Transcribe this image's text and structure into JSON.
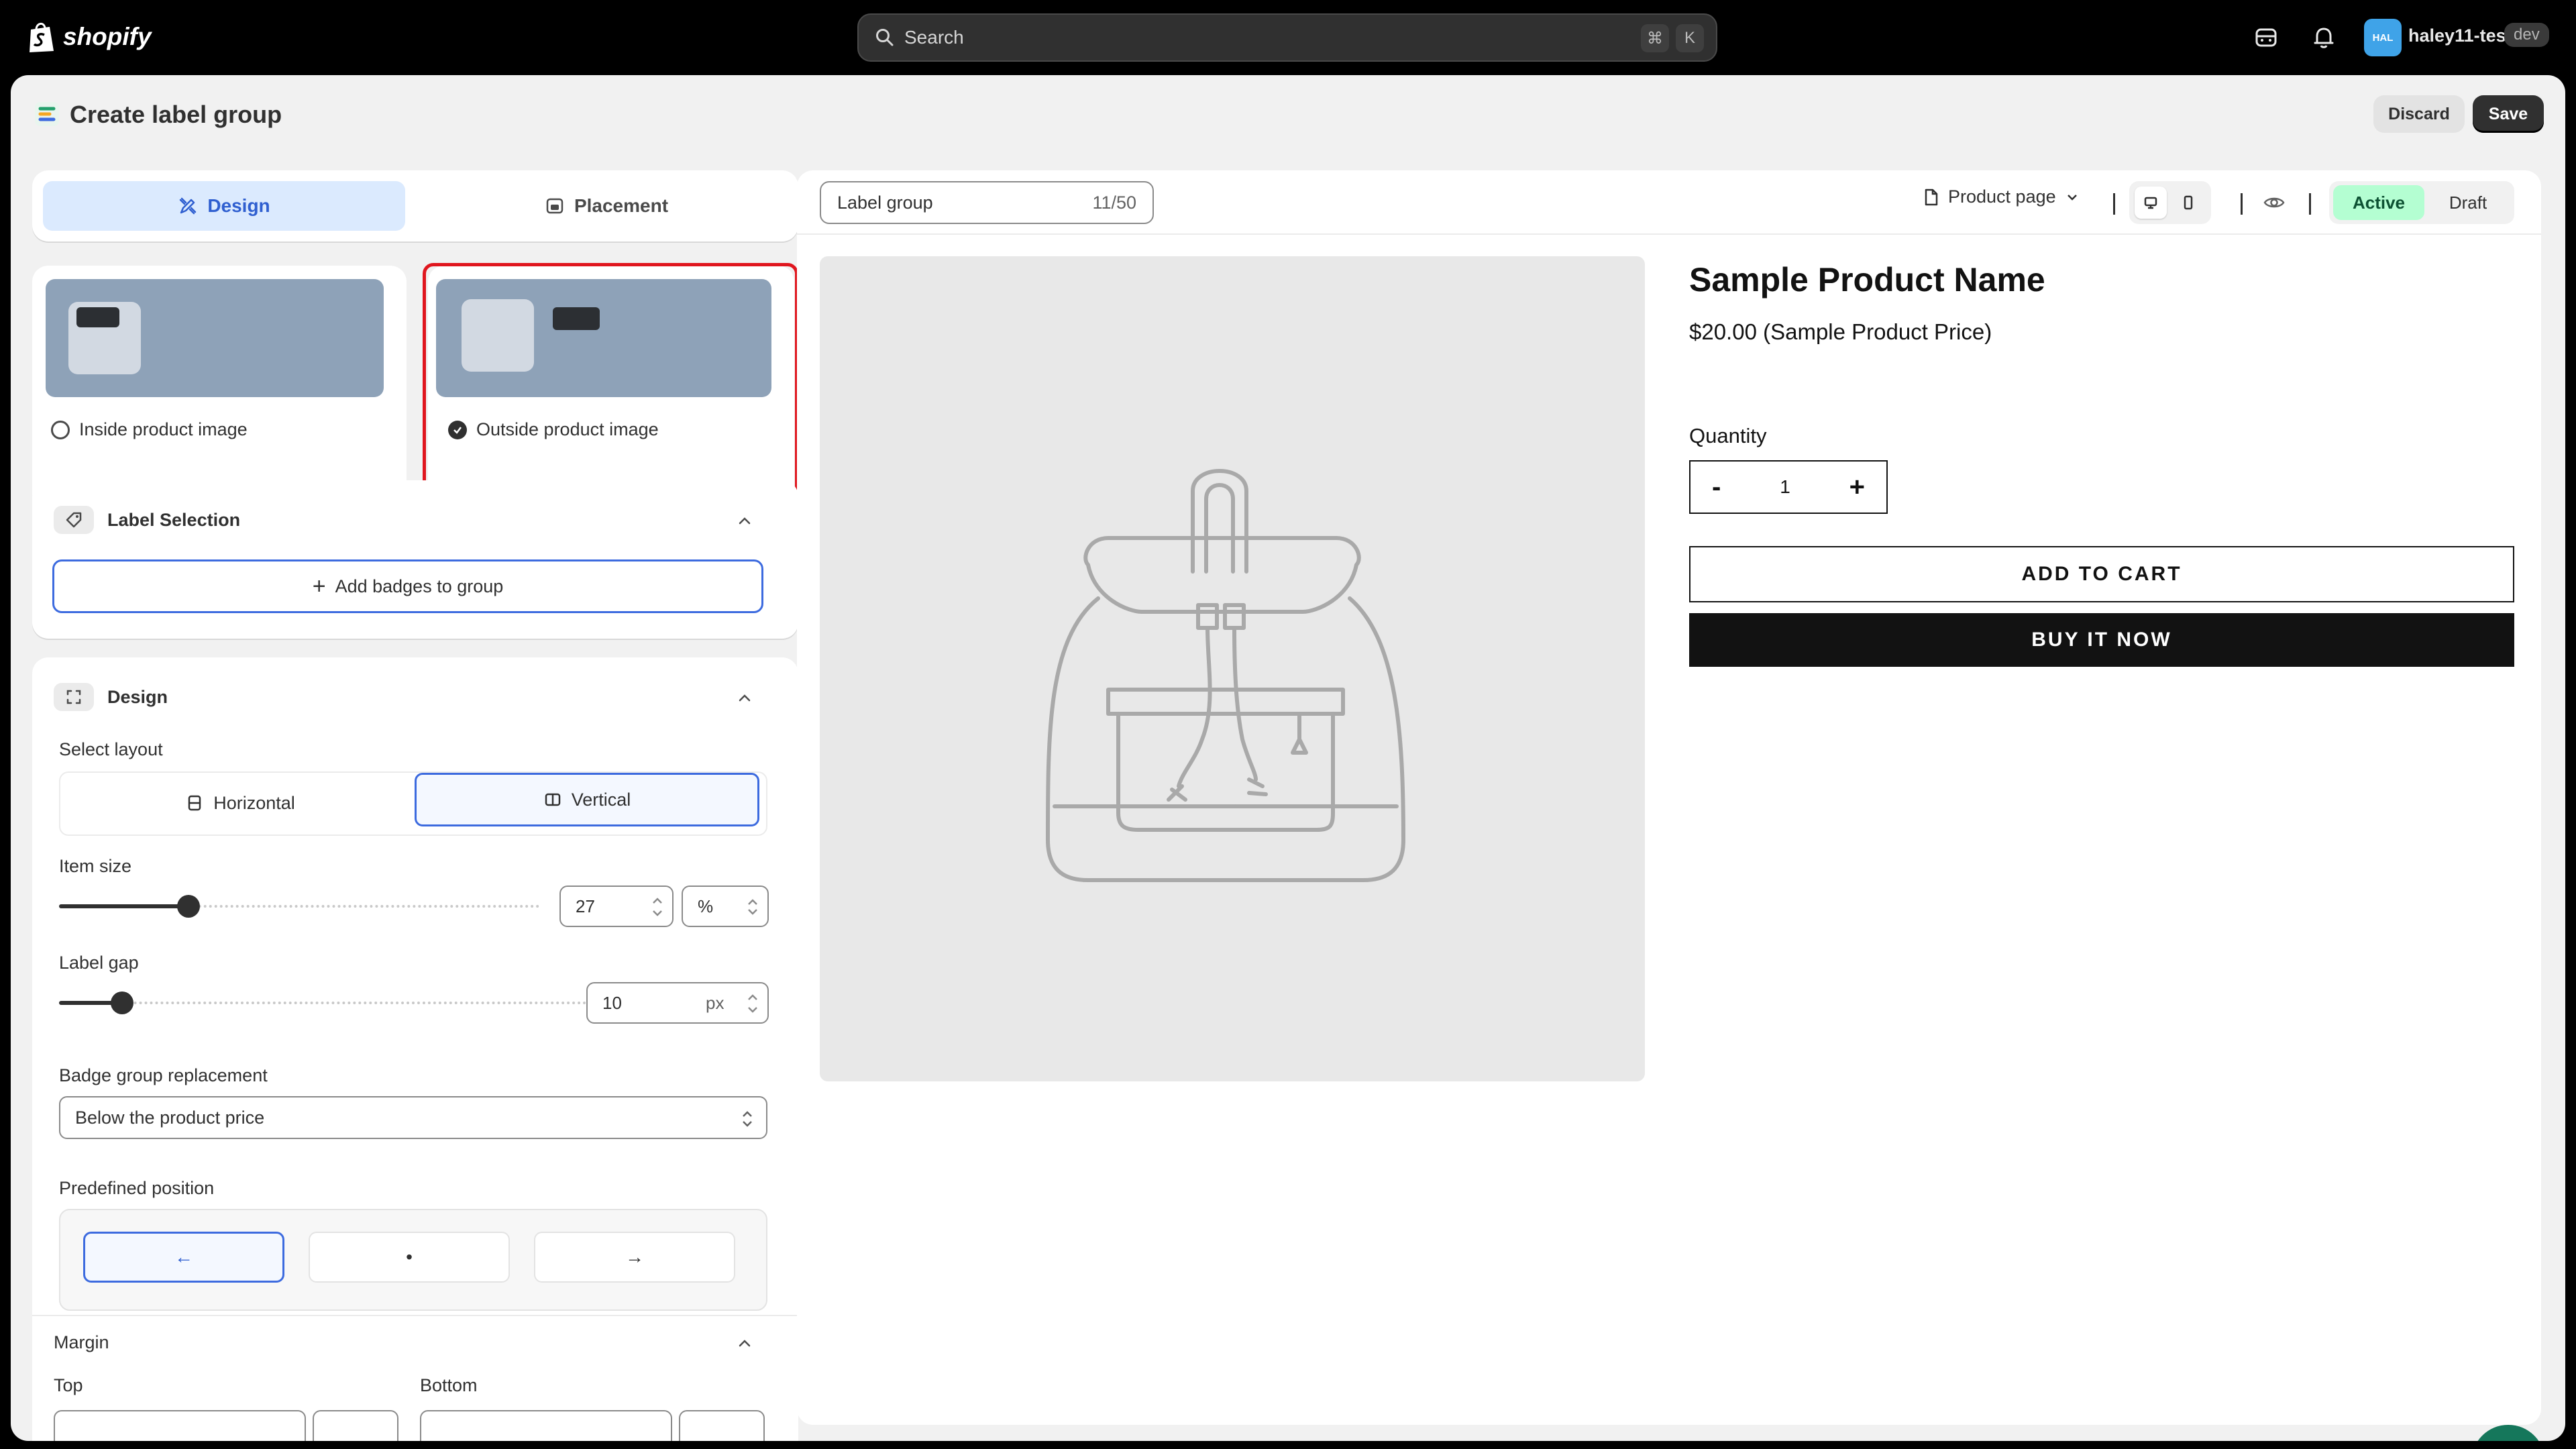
{
  "topbar": {
    "brand": "shopify",
    "search_placeholder": "Search",
    "shortcut_cmd": "⌘",
    "shortcut_key": "K",
    "avatar_initials": "HAL",
    "store_name": "haley11-test",
    "env_badge": "dev"
  },
  "page": {
    "title": "Create label group",
    "discard_label": "Discard",
    "save_label": "Save"
  },
  "tabs": [
    {
      "label": "Design",
      "active": true
    },
    {
      "label": "Placement",
      "active": false
    }
  ],
  "position_options": [
    {
      "label": "Inside product image",
      "selected": false
    },
    {
      "label": "Outside product image",
      "selected": true
    }
  ],
  "label_selection": {
    "title": "Label Selection",
    "add_button": "Add badges to group"
  },
  "design": {
    "title": "Design",
    "layout_label": "Select layout",
    "layout_options": [
      {
        "label": "Horizontal",
        "selected": false
      },
      {
        "label": "Vertical",
        "selected": true
      }
    ],
    "item_size_label": "Item size",
    "item_size_value": "27",
    "item_size_unit": "%",
    "item_size_fraction": 0.27,
    "label_gap_label": "Label gap",
    "label_gap_value": "10",
    "label_gap_unit": "px",
    "label_gap_fraction": 0.12,
    "replacement_label": "Badge group replacement",
    "replacement_value": "Below the product price",
    "predefined_label": "Predefined position",
    "predefined_options": [
      "←",
      "•",
      "→"
    ],
    "margin_title": "Margin",
    "margin_top_label": "Top",
    "margin_bottom_label": "Bottom"
  },
  "preview": {
    "group_name": "Label group",
    "char_count": "11/50",
    "page_select": "Product page",
    "status_active": "Active",
    "status_draft": "Draft",
    "product_name": "Sample Product Name",
    "product_price": "$20.00 (Sample Product Price)",
    "quantity_label": "Quantity",
    "qty_minus": "-",
    "qty_value": "1",
    "qty_plus": "+",
    "add_to_cart": "ADD TO CART",
    "buy_now": "BUY IT NOW"
  },
  "colors": {
    "accent_blue": "#3d6bdf",
    "tab_active_bg": "#dbeafe",
    "status_active_bg": "#b4fed2",
    "highlight_red": "#e0161e",
    "chat_green": "#15775b"
  }
}
